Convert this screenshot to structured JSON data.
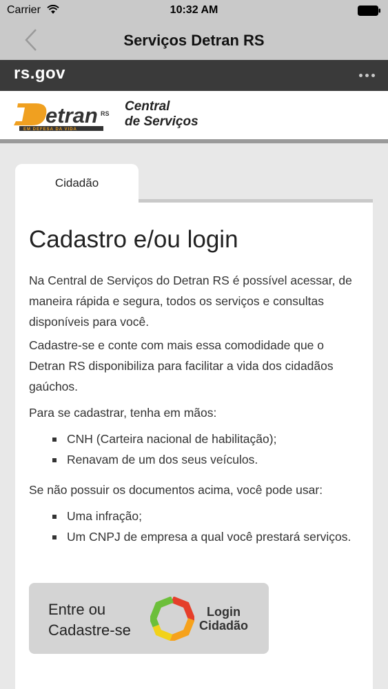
{
  "status_bar": {
    "carrier": "Carrier",
    "time": "10:32 AM"
  },
  "nav": {
    "title": "Serviços Detran RS",
    "back_icon": "chevron-left-icon"
  },
  "gov_bar": {
    "logo_text": "rs.gov",
    "more_icon": "ellipsis-icon"
  },
  "brand": {
    "logo_text": "Detran",
    "logo_superscript": "RS",
    "logo_tagline": "EM DEFESA DA VIDA",
    "central_line1": "Central",
    "central_line2": "de Serviços"
  },
  "tab": {
    "label": "Cidadão"
  },
  "main": {
    "title": "Cadastro e/ou login",
    "paragraph1": "Na Central de Serviços do Detran RS é possível acessar, de maneira rápida e segura, todos os serviços e consultas disponíveis para você.",
    "paragraph2": "Cadastre-se e conte com mais essa comodidade que o Detran RS disponibiliza para facilitar a vida dos cidadãos gaúchos.",
    "paragraph3": "Para se cadastrar, tenha em mãos:",
    "list1": [
      "CNH (Carteira nacional de habilitação);",
      "Renavam de um dos seus veículos."
    ],
    "paragraph4": "Se não possuir os documentos acima, você pode usar:",
    "list2": [
      "Uma infração;",
      "Um CNPJ de empresa a qual você prestará serviços."
    ]
  },
  "login_button": {
    "label_line1": "Entre ou",
    "label_line2": "Cadastre-se",
    "logo_line1": "Login",
    "logo_line2": "Cidadão"
  },
  "colors": {
    "bar_gray": "#c9c9c9",
    "gov_bar": "#3a3a3a",
    "detran_orange": "#f0a020",
    "button_bg": "#d4d4d4"
  }
}
